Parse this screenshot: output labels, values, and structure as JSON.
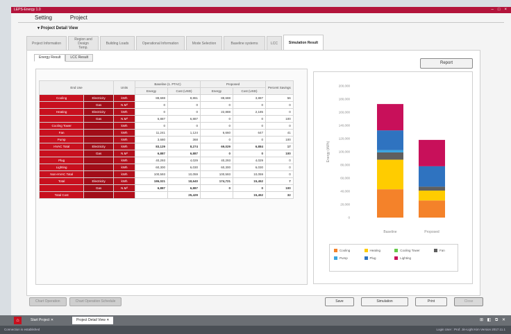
{
  "app": {
    "title": "LEPS-Energy 1.0"
  },
  "menu": {
    "items": [
      "Setting",
      "Project"
    ]
  },
  "section_title": "▾ Project Detail View",
  "tabs": [
    {
      "label": "Project Information",
      "active": false
    },
    {
      "label": "Region and Design Temp.",
      "active": false
    },
    {
      "label": "Building Loads",
      "active": false
    },
    {
      "label": "Operational Information",
      "active": false
    },
    {
      "label": "Mode Selection",
      "active": false
    },
    {
      "label": "Baseline systems",
      "active": false
    },
    {
      "label": "LCC",
      "active": false
    },
    {
      "label": "Simulation Result",
      "active": true
    }
  ],
  "subtabs": [
    {
      "label": "Energy Result",
      "active": true
    },
    {
      "label": "LCC Result",
      "active": false
    }
  ],
  "report_button": "Report",
  "table": {
    "headers": {
      "end_use": "End Use",
      "units": "Units",
      "baseline": "Baseline (1. PTAC)",
      "proposed": "Proposed",
      "percent": "Percent Savings",
      "energy": "Energy",
      "cost": "Cost (USD)"
    },
    "rows": [
      {
        "end_use": "Cooling",
        "fuel": "Electricity",
        "unit": "kWh",
        "b_energy": "88,688",
        "b_cost": "8,861",
        "p_energy": "88,688",
        "p_cost": "3,887",
        "pct": "56"
      },
      {
        "end_use": "",
        "fuel": "Gas",
        "unit": "N.M³",
        "b_energy": "0",
        "b_cost": "0",
        "p_energy": "0",
        "p_cost": "0",
        "pct": "0"
      },
      {
        "end_use": "Heating",
        "fuel": "Electricity",
        "unit": "kWh",
        "b_energy": "0",
        "b_cost": "0",
        "p_energy": "22,888",
        "p_cost": "2,185",
        "pct": "0"
      },
      {
        "end_use": "",
        "fuel": "Gas",
        "unit": "N.M³",
        "b_energy": "6,887",
        "b_cost": "6,887",
        "p_energy": "0",
        "p_cost": "0",
        "pct": "100"
      },
      {
        "end_use": "Cooling Tower",
        "fuel": "",
        "unit": "kWh",
        "b_energy": "0",
        "b_cost": "0",
        "p_energy": "0",
        "p_cost": "0",
        "pct": "0"
      },
      {
        "end_use": "Fan",
        "fuel": "",
        "unit": "kWh",
        "b_energy": "11,241",
        "b_cost": "1,124",
        "p_energy": "6,660",
        "p_cost": "647",
        "pct": "41"
      },
      {
        "end_use": "Pump",
        "fuel": "",
        "unit": "kWh",
        "b_energy": "3,680",
        "b_cost": "368",
        "p_energy": "0",
        "p_cost": "0",
        "pct": "100"
      },
      {
        "end_use": "HVAC Total",
        "fuel": "Electricity",
        "unit": "kWh",
        "b_energy": "83,129",
        "b_cost": "8,274",
        "p_energy": "69,029",
        "p_cost": "6,884",
        "pct": "17",
        "bold": true
      },
      {
        "end_use": "",
        "fuel": "Gas",
        "unit": "N.M³",
        "b_energy": "6,887",
        "b_cost": "6,887",
        "p_energy": "0",
        "p_cost": "0",
        "pct": "100",
        "bold": true
      },
      {
        "end_use": "Plug",
        "fuel": "",
        "unit": "kWh",
        "b_energy": "40,293",
        "b_cost": "4,029",
        "p_energy": "40,293",
        "p_cost": "4,029",
        "pct": "0"
      },
      {
        "end_use": "Lighting",
        "fuel": "",
        "unit": "kWh",
        "b_energy": "60,300",
        "b_cost": "6,030",
        "p_energy": "60,300",
        "p_cost": "6,030",
        "pct": "0"
      },
      {
        "end_use": "Non-HVAC Total",
        "fuel": "",
        "unit": "kWh",
        "b_energy": "100,593",
        "b_cost": "10,059",
        "p_energy": "100,593",
        "p_cost": "10,059",
        "pct": "0"
      },
      {
        "end_use": "Total",
        "fuel": "Electricity",
        "unit": "kWh",
        "b_energy": "186,021",
        "b_cost": "18,640",
        "p_energy": "174,721",
        "p_cost": "15,452",
        "pct": "7",
        "bold": true
      },
      {
        "end_use": "",
        "fuel": "Gas",
        "unit": "N.M³",
        "b_energy": "6,887",
        "b_cost": "6,887",
        "p_energy": "0",
        "p_cost": "0",
        "pct": "100",
        "bold": true
      },
      {
        "end_use": "Total Cost",
        "fuel": "",
        "unit": "",
        "b_energy": "",
        "b_cost": "25,429",
        "p_energy": "",
        "p_cost": "15,452",
        "pct": "32",
        "bold": true
      }
    ]
  },
  "chart_data": {
    "type": "bar",
    "stacked": true,
    "categories": [
      "Baseline",
      "Proposed"
    ],
    "ylabel": "Energy (kWh)",
    "ylim": [
      0,
      200000
    ],
    "yticks": [
      "200,000",
      "180,000",
      "160,000",
      "140,000",
      "120,000",
      "100,000",
      "80,000",
      "60,000",
      "40,000",
      "20,000",
      "0"
    ],
    "series": [
      {
        "name": "Cooling",
        "color": "#f4822a",
        "values": [
          43000,
          26000
        ]
      },
      {
        "name": "Heating",
        "color": "#ffcc00",
        "values": [
          45000,
          15000
        ]
      },
      {
        "name": "Cooling Tower",
        "color": "#66c94a",
        "values": [
          0,
          0
        ]
      },
      {
        "name": "Fan",
        "color": "#5f5f5f",
        "values": [
          11000,
          6000
        ]
      },
      {
        "name": "Pump",
        "color": "#3aa5e0",
        "values": [
          3500,
          0
        ]
      },
      {
        "name": "Plug",
        "color": "#2f73c0",
        "values": [
          30000,
          31000
        ]
      },
      {
        "name": "Lighting",
        "color": "#c8105a",
        "values": [
          40000,
          40000
        ]
      }
    ]
  },
  "bottom_left_buttons": [
    "Chart Operation",
    "Chart Operation Schedule"
  ],
  "bottom_right_buttons": [
    {
      "label": "Save",
      "disabled": false
    },
    {
      "label": "Simulation",
      "disabled": false
    },
    {
      "label": "Print",
      "disabled": false
    },
    {
      "label": "Close",
      "disabled": true
    }
  ],
  "taskbar": {
    "tabs": [
      {
        "label": "Start Project",
        "active": false
      },
      {
        "label": "Project Detail View",
        "active": true
      }
    ],
    "icons": "⊞ ◧ ⧉ ✕"
  },
  "statusbar": {
    "left": "Connection is established",
    "right": "Login User : Prof. Jin-Light Kim   Version 2017.11.1"
  }
}
